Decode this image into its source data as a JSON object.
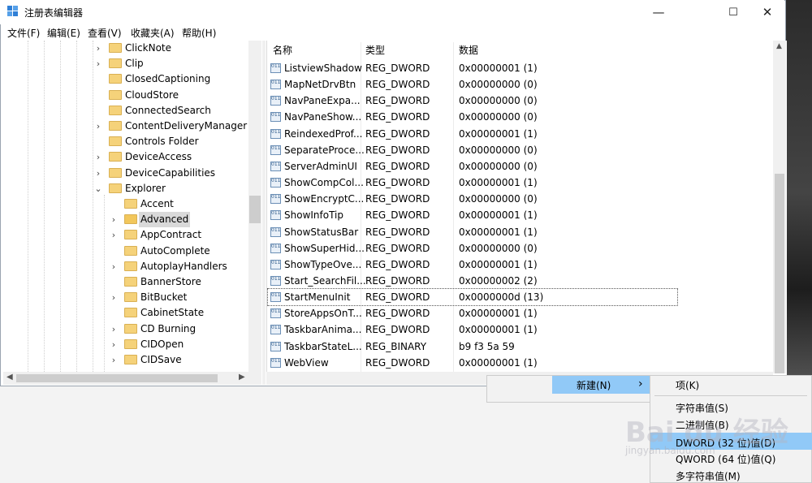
{
  "window": {
    "title": "注册表编辑器",
    "min": "—",
    "max": "☐",
    "close": "✕"
  },
  "menu": [
    "文件(F)",
    "编辑(E)",
    "查看(V)",
    "收藏夹(A)",
    "帮助(H)"
  ],
  "tree": [
    {
      "label": "ClickNote",
      "expandable": true,
      "level": 0
    },
    {
      "label": "Clip",
      "expandable": true,
      "level": 0
    },
    {
      "label": "ClosedCaptioning",
      "expandable": false,
      "level": 0
    },
    {
      "label": "CloudStore",
      "expandable": false,
      "level": 0
    },
    {
      "label": "ConnectedSearch",
      "expandable": false,
      "level": 0
    },
    {
      "label": "ContentDeliveryManager",
      "expandable": true,
      "level": 0
    },
    {
      "label": "Controls Folder",
      "expandable": false,
      "level": 0
    },
    {
      "label": "DeviceAccess",
      "expandable": true,
      "level": 0
    },
    {
      "label": "DeviceCapabilities",
      "expandable": true,
      "level": 0
    },
    {
      "label": "Explorer",
      "expandable": true,
      "expanded": true,
      "level": 0
    },
    {
      "label": "Accent",
      "expandable": false,
      "level": 1
    },
    {
      "label": "Advanced",
      "expandable": true,
      "level": 1,
      "selected": true
    },
    {
      "label": "AppContract",
      "expandable": true,
      "level": 1
    },
    {
      "label": "AutoComplete",
      "expandable": false,
      "level": 1
    },
    {
      "label": "AutoplayHandlers",
      "expandable": true,
      "level": 1
    },
    {
      "label": "BannerStore",
      "expandable": false,
      "level": 1
    },
    {
      "label": "BitBucket",
      "expandable": true,
      "level": 1
    },
    {
      "label": "CabinetState",
      "expandable": false,
      "level": 1
    },
    {
      "label": "CD Burning",
      "expandable": true,
      "level": 1
    },
    {
      "label": "CIDOpen",
      "expandable": true,
      "level": 1
    },
    {
      "label": "CIDSave",
      "expandable": true,
      "level": 1
    }
  ],
  "list": {
    "headers": {
      "name": "名称",
      "type": "类型",
      "data": "数据"
    },
    "rows": [
      {
        "name": "ListviewShadow",
        "type": "REG_DWORD",
        "data": "0x00000001 (1)"
      },
      {
        "name": "MapNetDrvBtn",
        "type": "REG_DWORD",
        "data": "0x00000000 (0)"
      },
      {
        "name": "NavPaneExpa...",
        "type": "REG_DWORD",
        "data": "0x00000000 (0)"
      },
      {
        "name": "NavPaneShow...",
        "type": "REG_DWORD",
        "data": "0x00000000 (0)"
      },
      {
        "name": "ReindexedProf...",
        "type": "REG_DWORD",
        "data": "0x00000001 (1)"
      },
      {
        "name": "SeparateProce...",
        "type": "REG_DWORD",
        "data": "0x00000000 (0)"
      },
      {
        "name": "ServerAdminUI",
        "type": "REG_DWORD",
        "data": "0x00000000 (0)"
      },
      {
        "name": "ShowCompCol...",
        "type": "REG_DWORD",
        "data": "0x00000001 (1)"
      },
      {
        "name": "ShowEncryptC...",
        "type": "REG_DWORD",
        "data": "0x00000000 (0)"
      },
      {
        "name": "ShowInfoTip",
        "type": "REG_DWORD",
        "data": "0x00000001 (1)"
      },
      {
        "name": "ShowStatusBar",
        "type": "REG_DWORD",
        "data": "0x00000001 (1)"
      },
      {
        "name": "ShowSuperHid...",
        "type": "REG_DWORD",
        "data": "0x00000000 (0)"
      },
      {
        "name": "ShowTypeOve...",
        "type": "REG_DWORD",
        "data": "0x00000001 (1)"
      },
      {
        "name": "Start_SearchFil...",
        "type": "REG_DWORD",
        "data": "0x00000002 (2)"
      },
      {
        "name": "StartMenuInit",
        "type": "REG_DWORD",
        "data": "0x0000000d (13)",
        "selected": true
      },
      {
        "name": "StoreAppsOnT...",
        "type": "REG_DWORD",
        "data": "0x00000001 (1)"
      },
      {
        "name": "TaskbarAnima...",
        "type": "REG_DWORD",
        "data": "0x00000001 (1)"
      },
      {
        "name": "TaskbarStateL...",
        "type": "REG_BINARY",
        "data": "b9 f3 5a 59"
      },
      {
        "name": "WebView",
        "type": "REG_DWORD",
        "data": "0x00000001 (1)"
      }
    ]
  },
  "context_menu": {
    "new_label": "新建(N)",
    "new_arrow": "›",
    "submenu": [
      "项(K)",
      "字符串值(S)",
      "二进制值(B)",
      "DWORD (32 位)值(D)",
      "QWORD (64 位)值(Q)",
      "多字符串值(M)"
    ]
  },
  "watermark": {
    "brand": "Bai du 经验",
    "url": "jingyan.baidu.com"
  },
  "colors": {
    "highlight": "#91c9f7",
    "folder": "#f5d27a",
    "selected_tree": "#d9d9d9"
  }
}
